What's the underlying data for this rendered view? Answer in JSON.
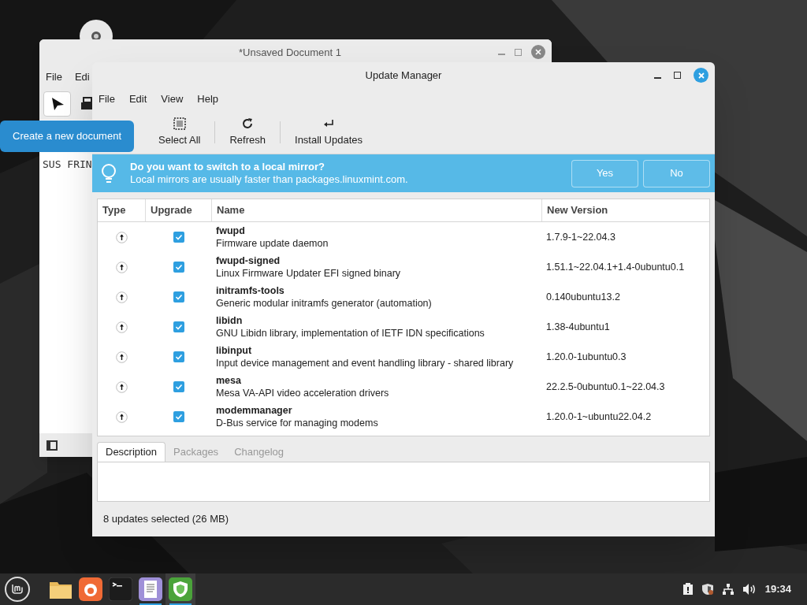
{
  "editor_window": {
    "title": "*Unsaved Document 1",
    "menu": [
      "File",
      "Edi"
    ],
    "text": "SUS FRIN"
  },
  "tooltip": "Create a new document",
  "update_manager": {
    "title": "Update Manager",
    "menu": [
      "File",
      "Edit",
      "View",
      "Help"
    ],
    "toolbar": [
      {
        "kind": "select",
        "label": "Select All"
      },
      {
        "kind": "refresh",
        "label": "Refresh"
      },
      {
        "kind": "install",
        "label": "Install Updates"
      }
    ],
    "infobar": {
      "title": "Do you want to switch to a local mirror?",
      "message": "Local mirrors are usually faster than packages.linuxmint.com.",
      "buttons": [
        "Yes",
        "No"
      ]
    },
    "table": {
      "columns": [
        "Type",
        "Upgrade",
        "Name",
        "New Version"
      ],
      "rows": [
        {
          "name": "fwupd",
          "description": "Firmware update daemon",
          "version": "1.7.9-1~22.04.3",
          "checked": true
        },
        {
          "name": "fwupd-signed",
          "description": "Linux Firmware Updater EFI signed binary",
          "version": "1.51.1~22.04.1+1.4-0ubuntu0.1",
          "checked": true
        },
        {
          "name": "initramfs-tools",
          "description": "Generic modular initramfs generator (automation)",
          "version": "0.140ubuntu13.2",
          "checked": true
        },
        {
          "name": "libidn",
          "description": "GNU Libidn library, implementation of IETF IDN specifications",
          "version": "1.38-4ubuntu1",
          "checked": true
        },
        {
          "name": "libinput",
          "description": "Input device management and event handling library - shared library",
          "version": "1.20.0-1ubuntu0.3",
          "checked": true
        },
        {
          "name": "mesa",
          "description": "Mesa VA-API video acceleration drivers",
          "version": "22.2.5-0ubuntu0.1~22.04.3",
          "checked": true
        },
        {
          "name": "modemmanager",
          "description": "D-Bus service for managing modems",
          "version": "1.20.0-1~ubuntu22.04.2",
          "checked": true
        }
      ]
    },
    "tabs": [
      {
        "label": "Description",
        "selected": true
      },
      {
        "label": "Packages",
        "selected": false
      },
      {
        "label": "Changelog",
        "selected": false
      }
    ],
    "status_bar": "8 updates selected (26 MB)"
  },
  "taskbar": {
    "apps": [
      {
        "kind": "folder",
        "running": false,
        "focused": false
      },
      {
        "kind": "browser",
        "running": false,
        "focused": false
      },
      {
        "kind": "terminal",
        "running": false,
        "focused": false
      },
      {
        "kind": "editor",
        "running": true,
        "focused": false
      },
      {
        "kind": "shield",
        "running": true,
        "focused": true
      }
    ],
    "tray": [
      {
        "kind": "alert"
      },
      {
        "kind": "shield"
      },
      {
        "kind": "network"
      },
      {
        "kind": "volume"
      }
    ],
    "clock": "19:34"
  }
}
